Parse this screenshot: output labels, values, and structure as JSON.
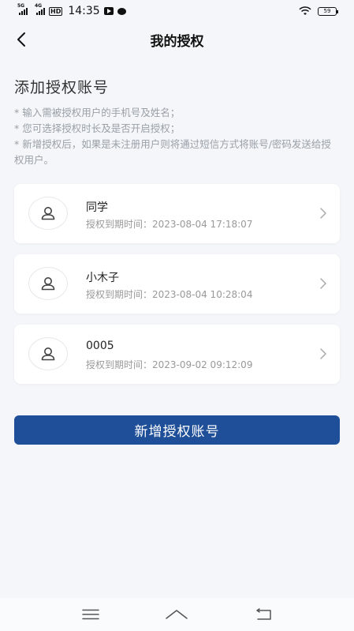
{
  "status_bar": {
    "sim1_label": "5G",
    "sim2_label": "4G",
    "hd_label": "HD",
    "time": "14:35",
    "battery": "59"
  },
  "header": {
    "title": "我的授权"
  },
  "section": {
    "title": "添加授权账号",
    "notes": [
      "* 输入需被授权用户的手机号及姓名；",
      "* 您可选择授权时长及是否开启授权；",
      "* 新增授权后，如果是未注册用户则将通过短信方式将账号/密码发送给授权用户。"
    ]
  },
  "accounts": [
    {
      "name": "同学",
      "expiry": "授权到期时间：2023-08-04 17:18:07"
    },
    {
      "name": "小木子",
      "expiry": "授权到期时间：2023-08-04 10:28:04"
    },
    {
      "name": "0005",
      "expiry": "授权到期时间：2023-09-02 09:12:09"
    }
  ],
  "actions": {
    "add_label": "新增授权账号"
  },
  "colors": {
    "accent": "#1f4f98",
    "background": "#f4f6f9",
    "muted_text": "#9aa0a8"
  },
  "icons": {
    "back": "chevron-left-icon",
    "avatar": "user-icon",
    "row_arrow": "chevron-right-icon",
    "nav_menu": "menu-icon",
    "nav_home": "home-icon",
    "nav_back": "return-icon"
  }
}
